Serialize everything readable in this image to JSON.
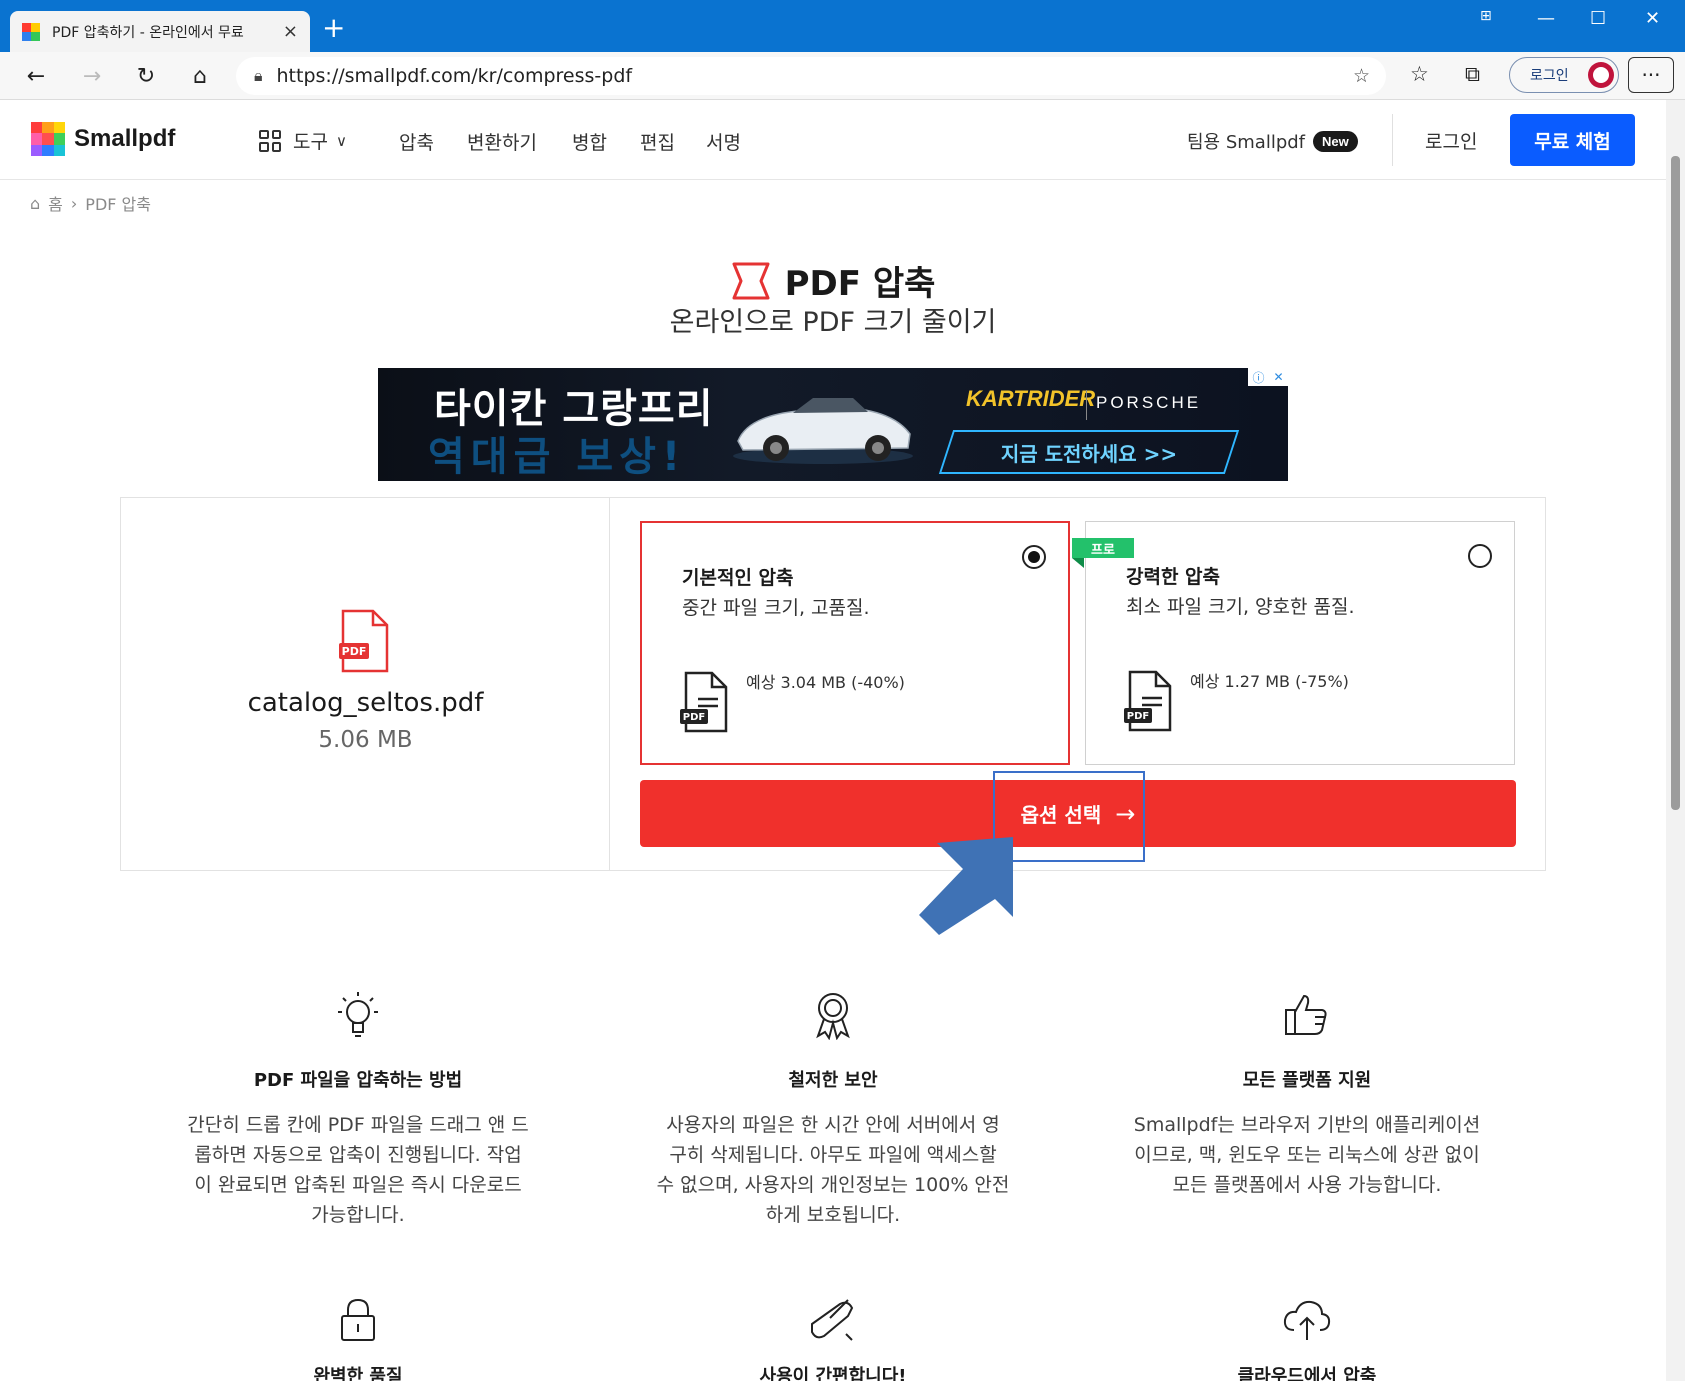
{
  "browser": {
    "tab_title": "PDF 압축하기 - 온라인에서 무료",
    "url": "https://smallpdf.com/kr/compress-pdf",
    "profile_label": "로그인"
  },
  "header": {
    "logo_text": "Smallpdf",
    "tools_label": "도구",
    "menu": [
      "압축",
      "변환하기",
      "병합",
      "편집",
      "서명"
    ],
    "team_label": "팀용 Smallpdf",
    "new_badge": "New",
    "login": "로그인",
    "trial": "무료 체험"
  },
  "breadcrumb": {
    "home": "홈",
    "sep": "›",
    "current": "PDF 압축"
  },
  "hero": {
    "title": "PDF 압축",
    "subtitle": "온라인으로 PDF 크기 줄이기"
  },
  "ad": {
    "line1": "타이칸 그랑프리",
    "line2": "역대급 보상!",
    "brand1": "KARTRIDER",
    "brand2": "PORSCHE",
    "cta": "지금 도전하세요 >>"
  },
  "file": {
    "name": "catalog_seltos.pdf",
    "size": "5.06 MB",
    "badge": "PDF"
  },
  "options": [
    {
      "title": "기본적인 압축",
      "desc": "중간 파일 크기, 고품질.",
      "estimate": "예상 3.04 MB (-40%)",
      "selected": true,
      "doc_badge": "PDF"
    },
    {
      "title": "강력한 압축",
      "desc": "최소 파일 크기, 양호한 품질.",
      "estimate": "예상 1.27 MB (-75%)",
      "selected": false,
      "pro_tag": "프로",
      "doc_badge": "PDF"
    }
  ],
  "cta": {
    "label": "옵션 선택",
    "arrow": "→"
  },
  "features": [
    {
      "icon": "lightbulb-icon",
      "title": "PDF 파일을 압축하는 방법",
      "lines": [
        "간단히 드롭 칸에 PDF 파일을 드래그 앤 드",
        "롭하면 자동으로 압축이 진행됩니다. 작업",
        "이 완료되면 압축된 파일은 즉시 다운로드",
        "가능합니다."
      ]
    },
    {
      "icon": "award-ribbon-icon",
      "title": "철저한 보안",
      "lines": [
        "사용자의 파일은 한 시간 안에 서버에서 영",
        "구히 삭제됩니다. 아무도 파일에 액세스할",
        "수 없으며, 사용자의 개인정보는 100% 안전",
        "하게 보호됩니다."
      ]
    },
    {
      "icon": "thumbs-up-icon",
      "title": "모든 플랫폼 지원",
      "lines": [
        "Smallpdf는 브라우저 기반의 애플리케이션",
        "이므로, 맥, 윈도우 또는 리눅스에 상관 없이",
        "모든 플랫폼에서 사용 가능합니다."
      ]
    }
  ],
  "features_row2": [
    {
      "icon": "padlock-icon",
      "title": "완벽한 품질"
    },
    {
      "icon": "swiss-knife-icon",
      "title": "사용이 간편합니다!"
    },
    {
      "icon": "cloud-upload-icon",
      "title": "클라우드에서 압축"
    }
  ]
}
